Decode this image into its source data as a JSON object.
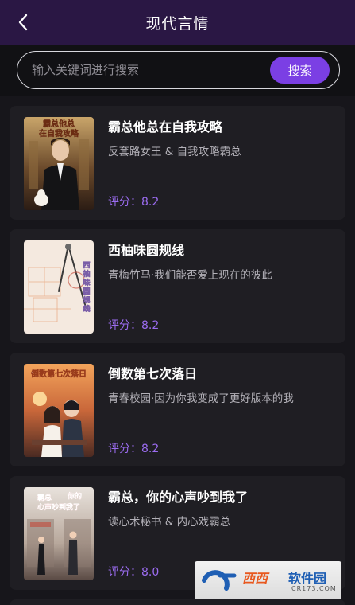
{
  "header": {
    "title": "现代言情",
    "back_icon": "chevron-left-icon"
  },
  "search": {
    "placeholder": "输入关键词进行搜索",
    "value": "",
    "button_label": "搜索"
  },
  "books": [
    {
      "title": "霸总他总在自我攻略",
      "desc": "反套路女王 & 自我攻略霸总",
      "rating": "评分：8.2",
      "cover_text": "霸总他总在自我攻略"
    },
    {
      "title": "西柚味圆规线",
      "desc": "青梅竹马·我们能否爱上现在的彼此",
      "rating": "评分：8.2",
      "cover_text": "西柚味圆规线"
    },
    {
      "title": "倒数第七次落日",
      "desc": "青春校园·因为你我变成了更好版本的我",
      "rating": "评分：8.2",
      "cover_text": "倒数第七次落日"
    },
    {
      "title": "霸总，你的心声吵到我了",
      "desc": "读心术秘书 & 内心戏霸总",
      "rating": "评分：8.0",
      "cover_text": "霸总，你的心声吵到我了"
    }
  ],
  "watermark": {
    "brand": "西西",
    "sub": "软件园",
    "domain": "CR173.COM"
  },
  "colors": {
    "accent": "#7b3fe4",
    "rating": "#9b6cf0",
    "header_bg": "#2a1744",
    "card_bg": "#1f1e23"
  }
}
